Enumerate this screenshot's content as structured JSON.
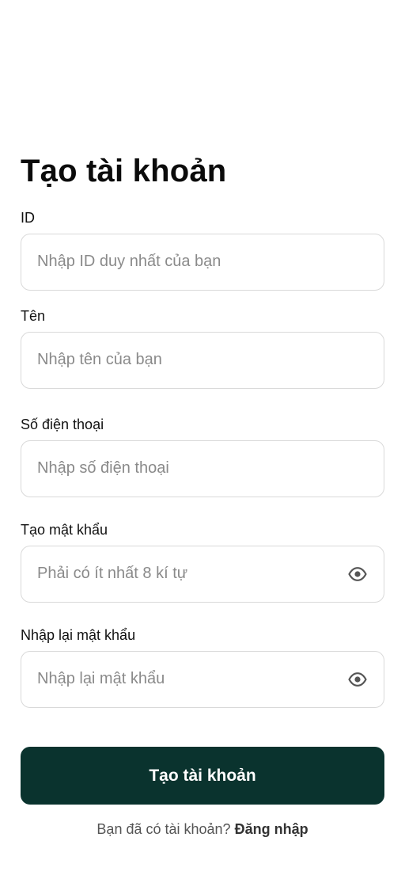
{
  "form": {
    "title": "Tạo tài khoản",
    "fields": [
      {
        "label": "ID",
        "placeholder": "Nhập ID duy nhất của bạn",
        "value": ""
      },
      {
        "label": "Tên",
        "placeholder": "Nhập tên của bạn",
        "value": ""
      },
      {
        "label": "Số điện thoại",
        "placeholder": "Nhập số điện thoại",
        "value": ""
      },
      {
        "label": "Tạo mật khẩu",
        "placeholder": "Phải có ít nhất 8 kí tự",
        "value": "",
        "icon": "eye-icon"
      },
      {
        "label": "Nhập lại mật khẩu",
        "placeholder": "Nhập lại mật khẩu",
        "value": "",
        "icon": "eye-icon"
      }
    ],
    "submit_label": "Tạo tài khoản",
    "footer_prompt": "Bạn đã có tài khoản?",
    "footer_link": "Đăng nhập"
  },
  "colors": {
    "primary_button": "#0a332e",
    "input_border": "#d9d9d9",
    "placeholder": "#8a8a8a",
    "icon": "#555555"
  }
}
